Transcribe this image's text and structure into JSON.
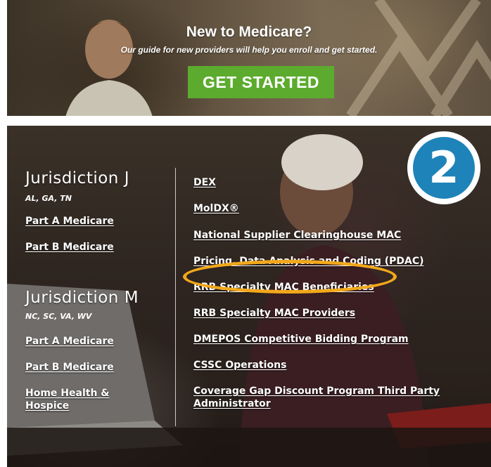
{
  "banner": {
    "title": "New to Medicare?",
    "subtitle": "Our guide for new providers will help you enroll and get started.",
    "cta_label": "GET STARTED",
    "cta_color": "#5cab2e"
  },
  "annotation": {
    "step_number": "2",
    "badge_color": "#1e83b8",
    "highlight_color": "#f2a81b"
  },
  "jurisdictions": [
    {
      "title": "Jurisdiction J",
      "states": "AL, GA, TN",
      "links": [
        "Part A Medicare",
        "Part B Medicare"
      ]
    },
    {
      "title": "Jurisdiction M",
      "states": "NC, SC, VA, WV",
      "links": [
        "Part A Medicare",
        "Part B Medicare",
        "Home Health & Hospice"
      ]
    }
  ],
  "programs": [
    "DEX",
    "MolDX®",
    "National Supplier Clearinghouse MAC",
    "Pricing, Data Analysis and Coding (PDAC)",
    "RRB Specialty MAC Beneficiaries",
    "RRB Specialty MAC Providers",
    "DMEPOS Competitive Bidding Program",
    "CSSC Operations",
    "Coverage Gap Discount Program Third Party Administrator"
  ]
}
